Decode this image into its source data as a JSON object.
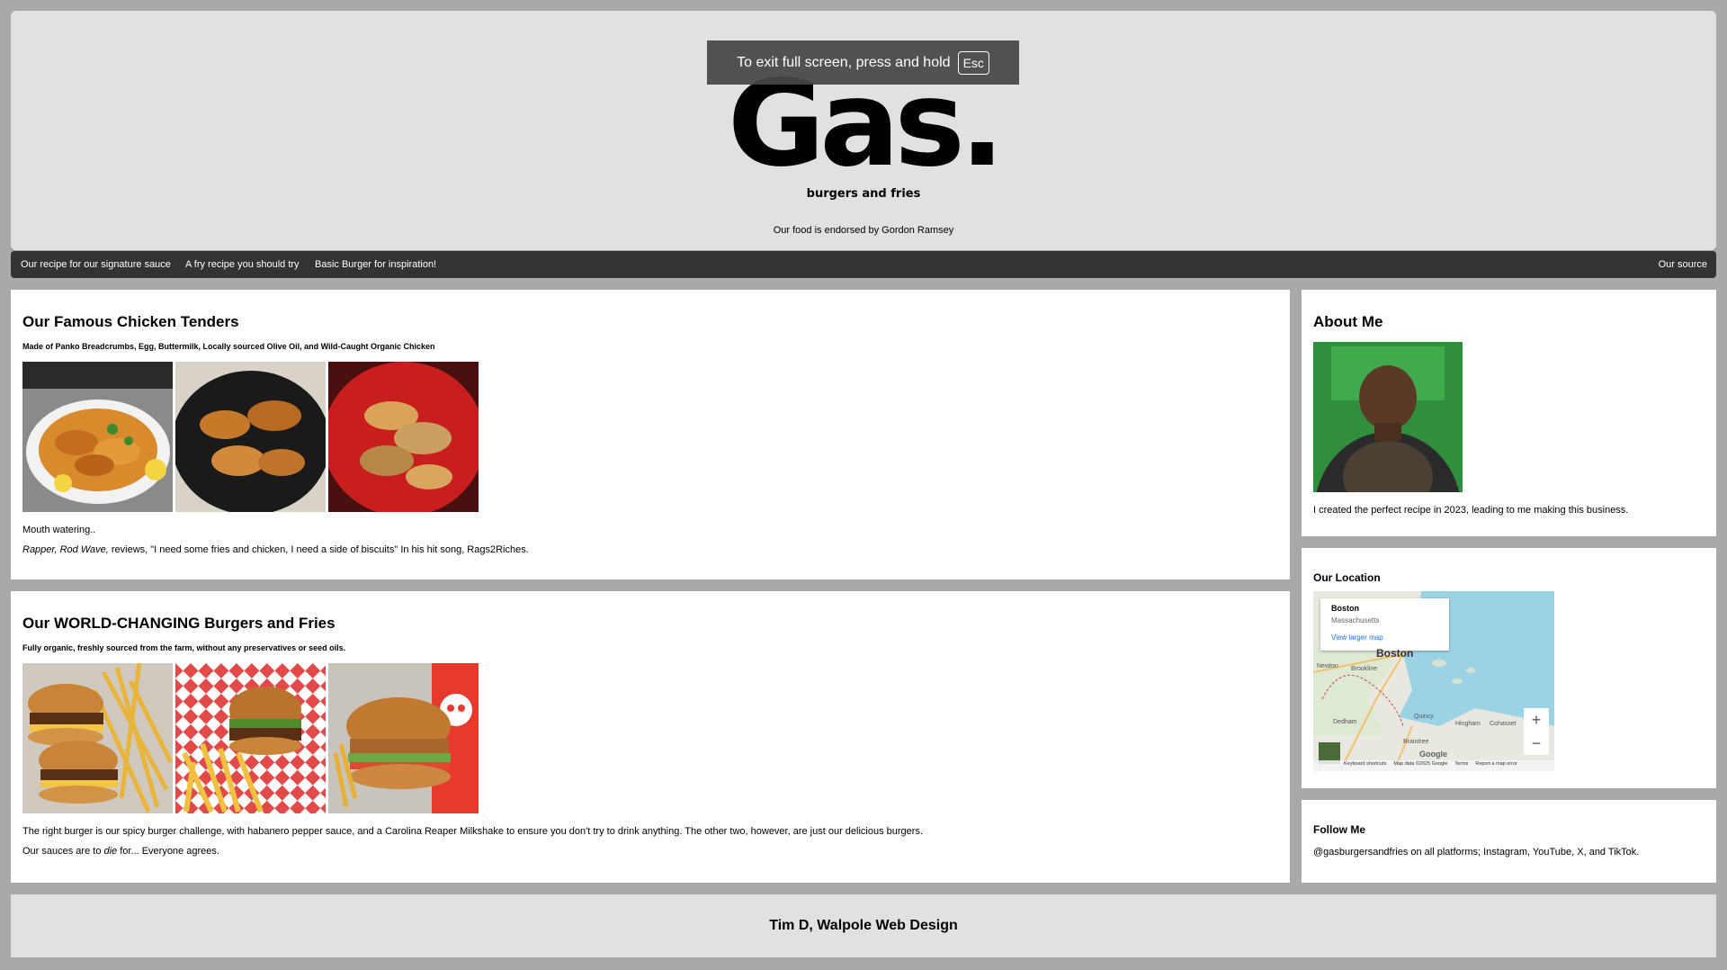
{
  "header": {
    "logo_text": "Gas.",
    "logo_subtitle": "burgers and fries",
    "endorsement": "Our food is endorsed by Gordon Ramsey",
    "fullscreen_notice": "To exit full screen, press and hold",
    "fullscreen_key": "Esc"
  },
  "nav": {
    "items": [
      {
        "label": "Our recipe for our signature sauce"
      },
      {
        "label": "A fry recipe you should try"
      },
      {
        "label": "Basic Burger for inspiration!"
      }
    ],
    "right_item": {
      "label": "Our source"
    }
  },
  "tenders": {
    "title": "Our Famous Chicken Tenders",
    "subtitle": "Made of Panko Breadcrumbs, Egg, Buttermilk, Locally sourced Olive Oil, and Wild-Caught Organic Chicken",
    "caption": "Mouth watering..",
    "quote_name": "Rapper, Rod Wave,",
    "quote_text": " reviews, \"I need some fries and chicken, I need a side of biscuits\" In his hit song, Rags2Riches."
  },
  "burgers": {
    "title": "Our WORLD-CHANGING Burgers and Fries",
    "subtitle": "Fully organic, freshly sourced from the farm, without any preservatives or seed oils.",
    "desc": "The right burger is our spicy burger challenge, with habanero pepper sauce, and a Carolina Reaper Milkshake to ensure you don't try to drink anything. The other two, however, are just our delicious burgers.",
    "sauce_before": "Our sauces are to ",
    "sauce_em": "die",
    "sauce_after": " for... Everyone agrees."
  },
  "about": {
    "title": "About Me",
    "text": "I created the perfect recipe in 2023, leading to me making this business."
  },
  "location": {
    "title": "Our Location",
    "map": {
      "info_title": "Boston",
      "info_sub": "Massachusetts",
      "info_link": "View larger map",
      "city_label": "Boston",
      "labels": [
        "Newton",
        "Brookline",
        "Quincy",
        "Dedham",
        "Hingham",
        "Cohasset",
        "Braintree"
      ],
      "attribution": [
        "Keyboard shortcuts",
        "Map data ©2025 Google",
        "Terms",
        "Report a map error"
      ],
      "google_label": "Google",
      "zoom_in": "+",
      "zoom_out": "−"
    }
  },
  "follow": {
    "title": "Follow Me",
    "text": "@gasburgersandfries on all platforms; Instagram, YouTube, X, and TikTok."
  },
  "footer": {
    "text": "Tim D, Walpole Web Design"
  },
  "colors": {
    "page_bg": "#a9a9a9",
    "header_bg": "#e1e1e1",
    "nav_bg": "#333333",
    "water": "#9bd3e6",
    "land": "#e8e8e0"
  }
}
